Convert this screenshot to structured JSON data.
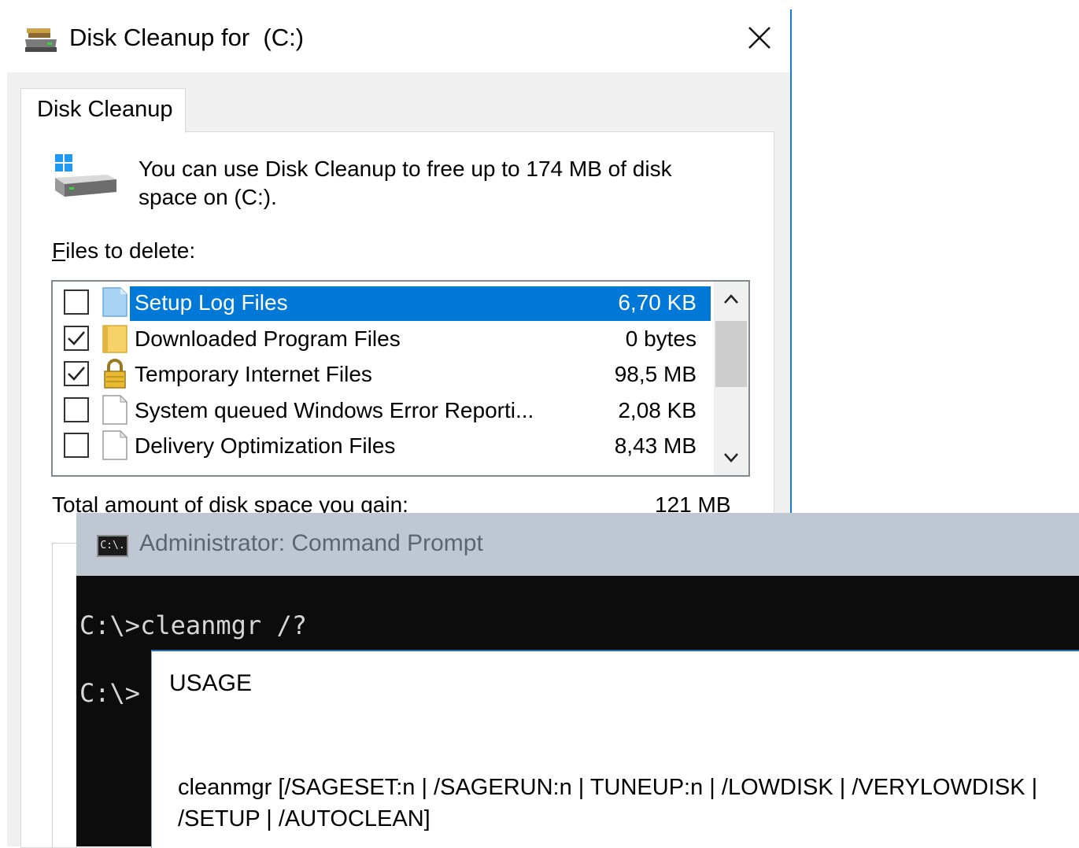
{
  "dialog": {
    "title": "Disk Cleanup for  (C:)",
    "close_icon": "close-icon",
    "tab_label": "Disk Cleanup",
    "info_text": "You can use Disk Cleanup to free up to 174 MB of disk space on  (C:).",
    "files_label_prefix": "F",
    "files_label_rest": "iles to delete:",
    "files": [
      {
        "name": "Setup Log Files",
        "size": "6,70 KB",
        "checked": false,
        "selected": true,
        "icon": "document-blue-icon"
      },
      {
        "name": "Downloaded Program Files",
        "size": "0 bytes",
        "checked": true,
        "selected": false,
        "icon": "folder-icon"
      },
      {
        "name": "Temporary Internet Files",
        "size": "98,5 MB",
        "checked": true,
        "selected": false,
        "icon": "lock-icon"
      },
      {
        "name": "System queued Windows Error Reporti...",
        "size": "2,08 KB",
        "checked": false,
        "selected": false,
        "icon": "document-icon"
      },
      {
        "name": "Delivery Optimization Files",
        "size": "8,43 MB",
        "checked": false,
        "selected": false,
        "icon": "document-icon"
      }
    ],
    "total_label": "Total amount of disk space you gain:",
    "total_value": "121 MB"
  },
  "cmd": {
    "title": "Administrator: Command Prompt",
    "icon_text": "C:\\.",
    "line1": "C:\\>cleanmgr /?",
    "line2": "C:\\>"
  },
  "usage": {
    "title": "USAGE",
    "text": "cleanmgr [/SAGESET:n | /SAGERUN:n | TUNEUP:n | /LOWDISK | /VERYLOWDISK | /SETUP | /AUTOCLEAN]"
  },
  "colors": {
    "selection": "#0078d7",
    "window_border": "#1979ca",
    "cmd_background": "#0c0c0c",
    "cmd_titlebar": "#bfc8d2"
  }
}
